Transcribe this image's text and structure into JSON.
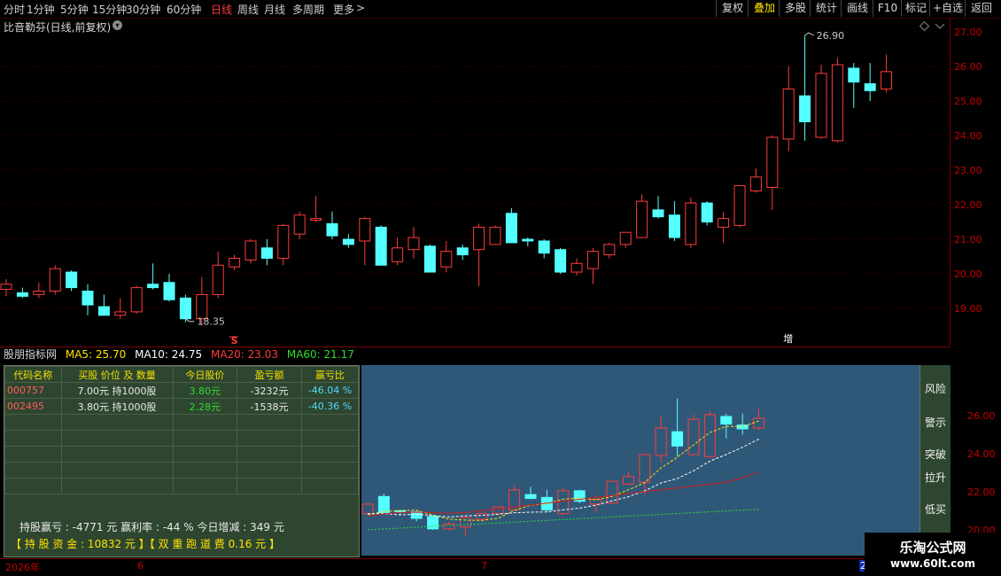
{
  "toolbar": {
    "periods": [
      {
        "label": "分时",
        "active": false
      },
      {
        "label": "1分钟",
        "active": false
      },
      {
        "label": "5分钟",
        "active": false
      },
      {
        "label": "15分钟",
        "active": false
      },
      {
        "label": "30分钟",
        "active": false
      },
      {
        "label": "60分钟",
        "active": false
      },
      {
        "label": "日线",
        "active": true
      },
      {
        "label": "周线",
        "active": false
      },
      {
        "label": "月线",
        "active": false
      },
      {
        "label": "多周期",
        "active": false
      },
      {
        "label": "更多",
        "active": false
      }
    ],
    "more_arrow": ">",
    "right_buttons": [
      {
        "label": "复权",
        "active": false
      },
      {
        "label": "叠加",
        "active": true
      },
      {
        "label": "多股",
        "active": false
      },
      {
        "label": "统计",
        "active": false
      },
      {
        "label": "画线",
        "active": false
      },
      {
        "label": "F10",
        "active": false
      },
      {
        "label": "标记",
        "active": false
      },
      {
        "label": "+自选",
        "active": false
      },
      {
        "label": "返回",
        "active": false
      }
    ]
  },
  "main_chart": {
    "title": "比音勒芬(日线,前复权)",
    "y_ticks": [
      "27.00",
      "26.00",
      "25.00",
      "24.00",
      "23.00",
      "22.00",
      "21.00",
      "20.00",
      "19.00"
    ],
    "high_label": "26.90",
    "low_label": "18.35",
    "marker_s": "S",
    "marker_zeng": "增",
    "candles": [
      [
        19.55,
        19.85,
        19.35,
        19.7
      ],
      [
        19.45,
        19.6,
        19.3,
        19.35
      ],
      [
        19.4,
        19.75,
        19.3,
        19.5
      ],
      [
        19.5,
        20.25,
        19.4,
        20.15
      ],
      [
        20.05,
        20.1,
        19.5,
        19.6
      ],
      [
        19.5,
        19.7,
        18.8,
        19.1
      ],
      [
        19.05,
        19.4,
        18.85,
        18.8
      ],
      [
        18.8,
        19.3,
        18.7,
        18.9
      ],
      [
        18.9,
        19.65,
        18.85,
        19.6
      ],
      [
        19.7,
        20.3,
        19.55,
        19.6
      ],
      [
        19.75,
        20.0,
        19.2,
        19.25
      ],
      [
        19.3,
        19.4,
        18.6,
        18.7
      ],
      [
        18.7,
        19.9,
        18.5,
        19.4
      ],
      [
        19.4,
        20.65,
        19.3,
        20.25
      ],
      [
        20.2,
        20.55,
        20.1,
        20.45
      ],
      [
        20.4,
        21.0,
        20.3,
        20.95
      ],
      [
        20.75,
        21.0,
        20.25,
        20.45
      ],
      [
        20.45,
        21.45,
        20.25,
        21.4
      ],
      [
        21.15,
        21.8,
        21.0,
        21.7
      ],
      [
        21.55,
        22.25,
        21.5,
        21.6
      ],
      [
        21.45,
        21.8,
        21.0,
        21.1
      ],
      [
        21.0,
        21.15,
        20.75,
        20.85
      ],
      [
        20.95,
        21.65,
        20.25,
        21.6
      ],
      [
        21.35,
        21.4,
        20.25,
        20.25
      ],
      [
        20.35,
        21.05,
        20.25,
        20.75
      ],
      [
        20.7,
        21.35,
        20.45,
        21.05
      ],
      [
        20.8,
        20.85,
        20.05,
        20.05
      ],
      [
        20.2,
        20.95,
        20.05,
        20.65
      ],
      [
        20.75,
        20.85,
        20.4,
        20.55
      ],
      [
        20.7,
        21.45,
        19.65,
        21.35
      ],
      [
        20.85,
        21.4,
        20.85,
        21.35
      ],
      [
        21.75,
        21.9,
        20.9,
        20.9
      ],
      [
        21.0,
        21.05,
        20.8,
        20.95
      ],
      [
        20.95,
        21.0,
        20.45,
        20.6
      ],
      [
        20.7,
        20.75,
        20.0,
        20.05
      ],
      [
        20.05,
        20.45,
        19.95,
        20.3
      ],
      [
        20.15,
        20.75,
        19.7,
        20.65
      ],
      [
        20.55,
        20.9,
        20.45,
        20.85
      ],
      [
        20.85,
        21.2,
        20.75,
        21.2
      ],
      [
        21.05,
        22.3,
        21.05,
        22.1
      ],
      [
        21.85,
        22.25,
        21.6,
        21.65
      ],
      [
        21.7,
        22.1,
        20.95,
        21.05
      ],
      [
        20.85,
        22.2,
        20.75,
        22.05
      ],
      [
        22.05,
        22.1,
        21.4,
        21.5
      ],
      [
        21.35,
        21.8,
        20.9,
        21.6
      ],
      [
        21.4,
        22.55,
        21.35,
        22.55
      ],
      [
        22.4,
        23.05,
        22.35,
        22.8
      ],
      [
        22.5,
        24.0,
        21.85,
        23.95
      ],
      [
        23.9,
        26.0,
        23.55,
        25.35
      ],
      [
        25.15,
        26.9,
        23.85,
        24.4
      ],
      [
        23.95,
        26.05,
        23.9,
        25.8
      ],
      [
        23.85,
        26.25,
        23.8,
        26.05
      ],
      [
        25.95,
        26.1,
        24.8,
        25.55
      ],
      [
        25.5,
        26.1,
        25.0,
        25.3
      ],
      [
        25.35,
        26.35,
        25.25,
        25.85
      ]
    ]
  },
  "indicator": {
    "name": "股朋指标网",
    "ma5": "MA5: 25.70",
    "ma10": "MA10: 24.75",
    "ma20": "MA20: 23.03",
    "ma60": "MA60: 21.17",
    "colors": {
      "ma5": "#ffe400",
      "ma10": "#ffffff",
      "ma20": "#ff3b3b",
      "ma60": "#2fdc2f"
    }
  },
  "holdings_table": {
    "headers": [
      "代码名称",
      "买股 价位 及 数量",
      "今日股价",
      "盈亏额",
      "赢亏比"
    ],
    "rows": [
      {
        "code": "000757",
        "buy": "7.00元  持1000股",
        "price": "3.80元",
        "pl": "-3232元",
        "ratio": "-46.04 %"
      },
      {
        "code": "002495",
        "buy": "3.80元  持1000股",
        "price": "2.28元",
        "pl": "-1538元",
        "ratio": "-40.36 %"
      }
    ],
    "empty_rows": 5
  },
  "summary": {
    "line1": "持股赢亏 : -4771 元      赢利率 : -44 %      今日增减 : 349 元",
    "line2": "【  持 股 资 金 : 10832 元   】【  双 重 跑 道 费  0.16 元   】"
  },
  "mini_chart": {
    "y_ticks": [
      "26.00",
      "24.00",
      "22.00",
      "20.00"
    ]
  },
  "side_buttons": [
    "风险",
    "警示",
    "突破",
    "拉升",
    "低买"
  ],
  "bottom_bar": {
    "year": "2026年",
    "month6": "6",
    "month7": "7",
    "month2": "2"
  },
  "watermark": {
    "line1": "乐淘公式网",
    "line2": "www.60lt.com"
  }
}
